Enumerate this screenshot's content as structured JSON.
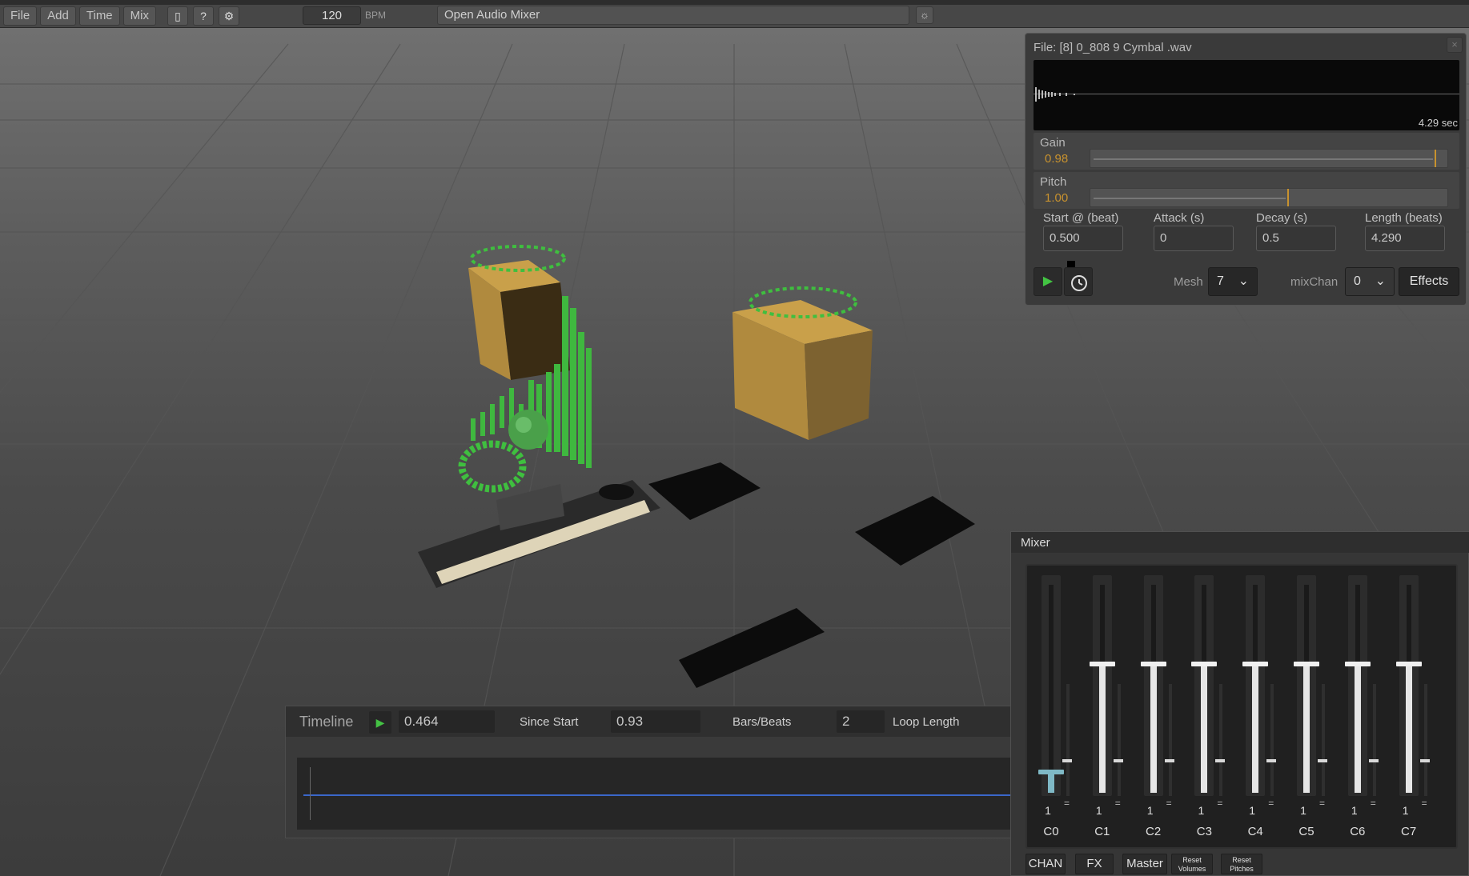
{
  "menubar": {
    "items": [
      "File",
      "Add",
      "Time",
      "Mix"
    ],
    "icons": [
      "book-icon",
      "help-icon",
      "gear-icon"
    ],
    "icon_glyphs": [
      "▯",
      "?",
      "⚙"
    ],
    "bpm_value": "120",
    "bpm_label": "BPM",
    "mixer_button": "Open Audio Mixer",
    "sun_glyph": "☼"
  },
  "file_panel": {
    "title": "File:  [8] 0_808 9 Cymbal .wav",
    "close": "×",
    "duration": "4.29 sec",
    "gain": {
      "label": "Gain",
      "value": "0.98",
      "fraction": 0.96
    },
    "pitch": {
      "label": "Pitch",
      "value": "1.00",
      "fraction": 0.55
    },
    "fields": [
      {
        "label": "Start @ (beat)",
        "value": "0.500"
      },
      {
        "label": "Attack (s)",
        "value": "0"
      },
      {
        "label": "Decay (s)",
        "value": "0.5"
      },
      {
        "label": "Length (beats)",
        "value": "4.290"
      }
    ],
    "mesh_label": "Mesh",
    "mesh_value": "7",
    "mixchan_label": "mixChan",
    "mixchan_value": "0",
    "effects_label": "Effects"
  },
  "timeline": {
    "title": "Timeline",
    "time_value": "0.464",
    "since_start_label": "Since Start",
    "since_start_value": "0.93",
    "bars_beats_label": "Bars/Beats",
    "bars_beats_value": "2",
    "loop_length_label": "Loop Length"
  },
  "mixer": {
    "title": "Mixer",
    "channels": [
      {
        "name": "C0",
        "value": "1",
        "level": 0.1
      },
      {
        "name": "C1",
        "value": "1",
        "level": 0.62
      },
      {
        "name": "C2",
        "value": "1",
        "level": 0.62
      },
      {
        "name": "C3",
        "value": "1",
        "level": 0.62
      },
      {
        "name": "C4",
        "value": "1",
        "level": 0.62
      },
      {
        "name": "C5",
        "value": "1",
        "level": 0.62
      },
      {
        "name": "C6",
        "value": "1",
        "level": 0.62
      },
      {
        "name": "C7",
        "value": "1",
        "level": 0.62
      }
    ],
    "eq_glyph": "=",
    "buttons": [
      "CHAN",
      "FX",
      "Master"
    ],
    "reset_volumes": [
      "Reset",
      "Volumes"
    ],
    "reset_pitches": [
      "Reset",
      "Pitches"
    ]
  },
  "colors": {
    "accent_orange": "#c8922e",
    "play_green": "#43c443",
    "timeline_blue": "#3a66c9",
    "cube_gold": "#b08a3e"
  }
}
